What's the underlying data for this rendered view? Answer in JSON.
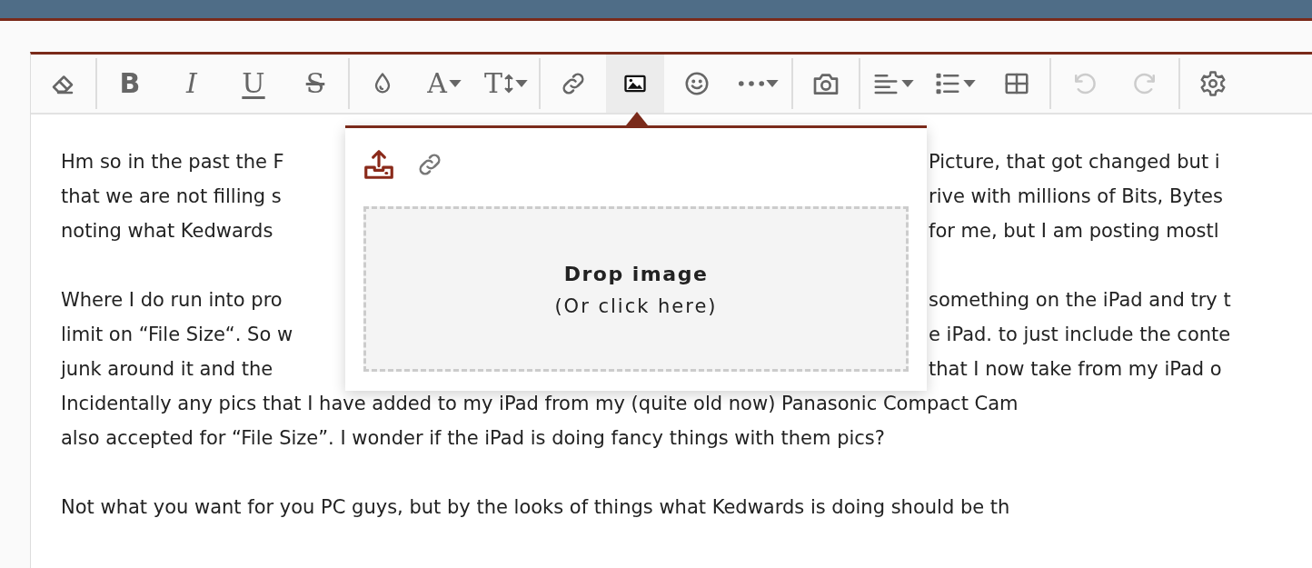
{
  "toolbar": [
    [
      {
        "kind": "eraser",
        "selected": false,
        "disabled": false,
        "dropdown": false
      }
    ],
    [
      {
        "kind": "bold",
        "label": "B",
        "selected": false,
        "disabled": false,
        "dropdown": false
      },
      {
        "kind": "italic",
        "label": "I",
        "selected": false,
        "disabled": false,
        "dropdown": false
      },
      {
        "kind": "underline",
        "label": "U",
        "selected": false,
        "disabled": false,
        "dropdown": false
      },
      {
        "kind": "strike",
        "label": "S",
        "selected": false,
        "disabled": false,
        "dropdown": false
      }
    ],
    [
      {
        "kind": "color",
        "selected": false,
        "disabled": false,
        "dropdown": false
      },
      {
        "kind": "font",
        "label": "A",
        "selected": false,
        "disabled": false,
        "dropdown": true
      },
      {
        "kind": "size",
        "label": "T",
        "selected": false,
        "disabled": false,
        "dropdown": true
      }
    ],
    [
      {
        "kind": "link",
        "selected": false,
        "disabled": false,
        "dropdown": false
      },
      {
        "kind": "image",
        "selected": true,
        "disabled": false,
        "dropdown": false
      },
      {
        "kind": "emoji",
        "selected": false,
        "disabled": false,
        "dropdown": false
      },
      {
        "kind": "more",
        "selected": false,
        "disabled": false,
        "dropdown": true
      }
    ],
    [
      {
        "kind": "camera",
        "selected": false,
        "disabled": false,
        "dropdown": false
      }
    ],
    [
      {
        "kind": "align",
        "selected": false,
        "disabled": false,
        "dropdown": true
      },
      {
        "kind": "list",
        "selected": false,
        "disabled": false,
        "dropdown": true
      },
      {
        "kind": "table",
        "selected": false,
        "disabled": false,
        "dropdown": false
      }
    ],
    [
      {
        "kind": "undo",
        "selected": false,
        "disabled": true,
        "dropdown": false
      },
      {
        "kind": "redo",
        "selected": false,
        "disabled": true,
        "dropdown": false
      }
    ],
    [
      {
        "kind": "settings",
        "selected": false,
        "disabled": false,
        "dropdown": false
      }
    ]
  ],
  "paragraphs": [
    [
      {
        "segments": [
          "Hm so in the past the F",
          "Picture, that got changed but i"
        ]
      },
      {
        "segments": [
          "that we are not filling s",
          "rive with millions of Bits, Bytes"
        ]
      },
      {
        "segments": [
          "noting what Kedwards",
          "for me, but I am posting mostl"
        ]
      }
    ],
    [
      {
        "segments": [
          "Where I do run into pro",
          "something on the iPad and try t"
        ]
      },
      {
        "segments": [
          "limit on “File Size“. So w",
          "e iPad. to just include the conte"
        ]
      },
      {
        "segments": [
          "junk around it and the",
          "that I now take from my iPad o"
        ]
      },
      {
        "segments": [
          "Incidentally any pics that I have added to my iPad from my (quite old now) Panasonic Compact Cam"
        ]
      },
      {
        "segments": [
          "also accepted for “File Size”. I wonder if the iPad is doing fancy things with them pics?"
        ]
      }
    ],
    [
      {
        "segments": [
          "Not what you want for you PC guys, but by the looks of things what Kedwards is doing should be th"
        ]
      }
    ]
  ],
  "image_popup": {
    "tabs": [
      {
        "kind": "upload",
        "selected": true
      },
      {
        "kind": "link",
        "selected": false
      }
    ],
    "drop_title": "Drop image",
    "drop_hint": "(Or click here)"
  }
}
